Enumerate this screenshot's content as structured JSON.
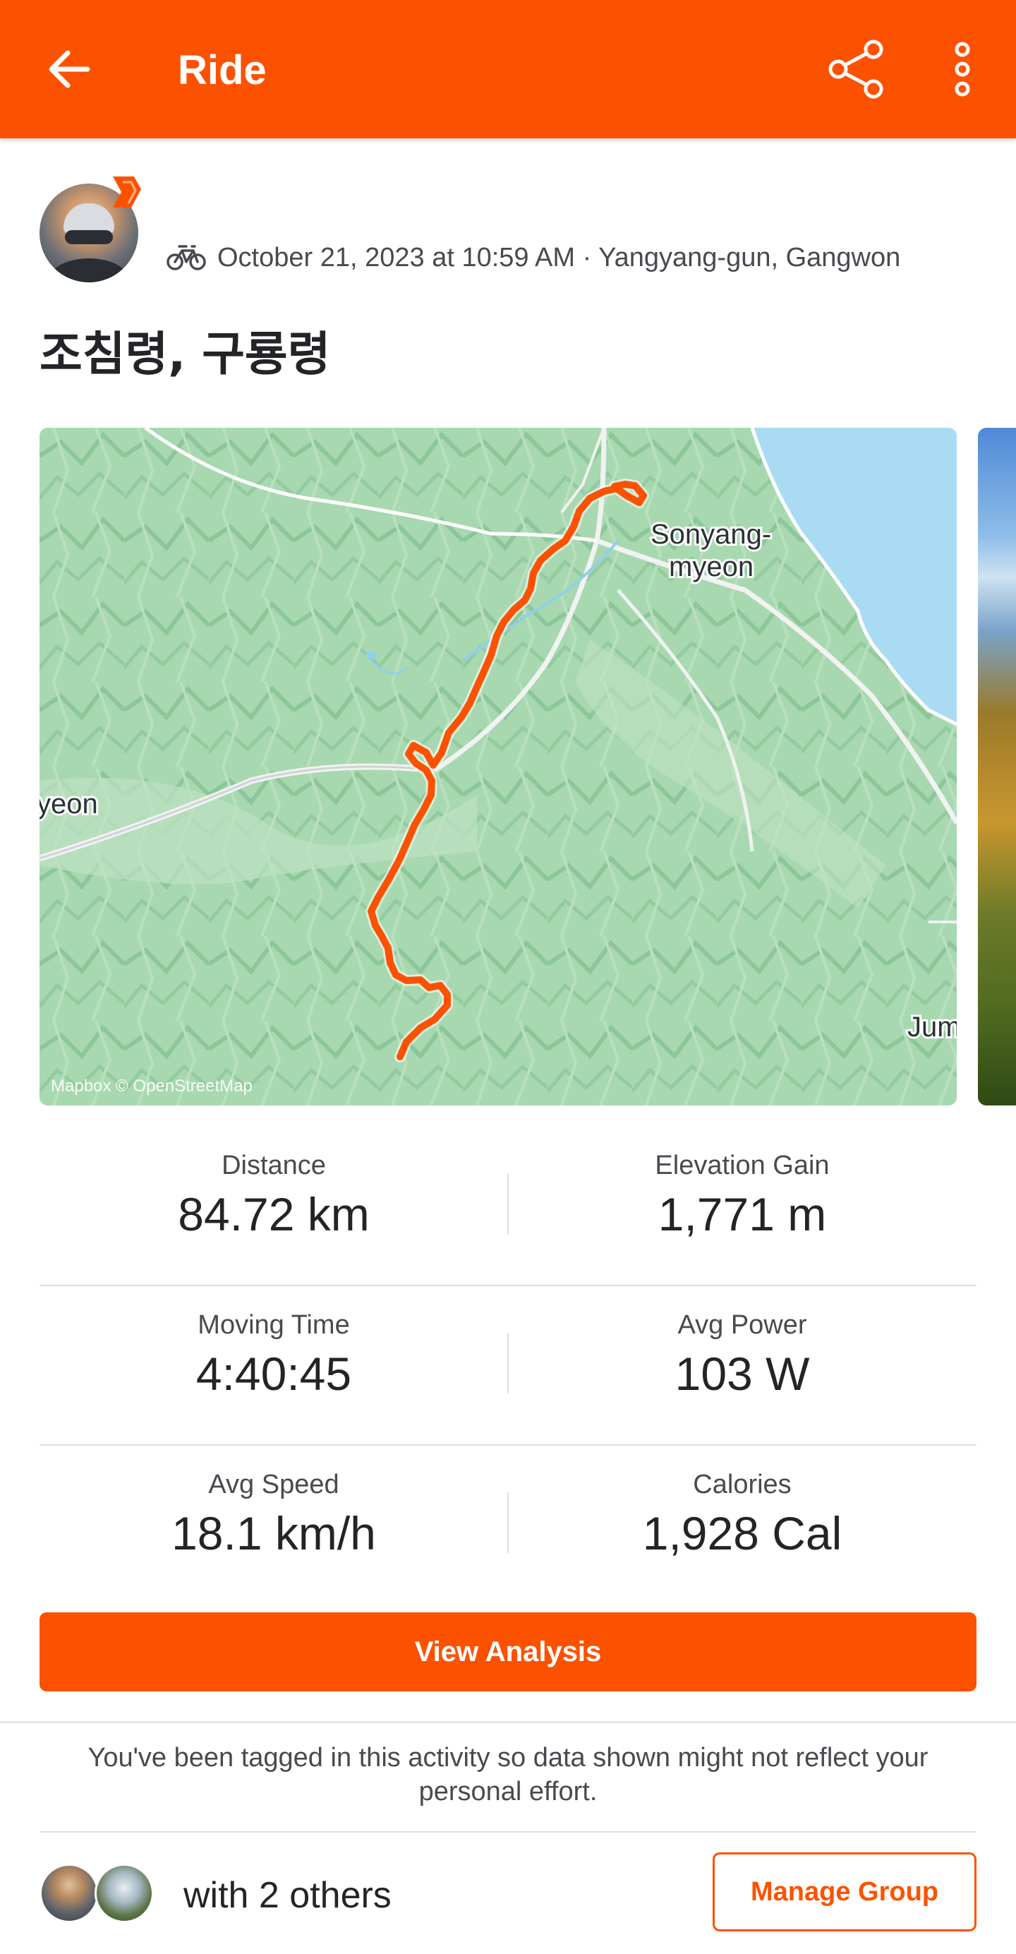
{
  "appbar": {
    "title": "Ride",
    "back_icon": "arrow-left-icon",
    "share_icon": "share-icon",
    "more_icon": "more-vertical-icon",
    "background": "#fc5200"
  },
  "activity": {
    "datetime_location": "October 21, 2023 at 10:59 AM · Yangyang-gun, Gangwon",
    "sport_icon": "bike-icon",
    "title": "조침령, 구룡령"
  },
  "map": {
    "labels": {
      "sonyang": "Sonyang-",
      "myeon": "myeon",
      "left": "yeon",
      "right": "Jum"
    },
    "attribution": "Mapbox © OpenStreetMap",
    "route_color": "#fc5200"
  },
  "stats": [
    {
      "label": "Distance",
      "value": "84.72 km"
    },
    {
      "label": "Elevation Gain",
      "value": "1,771 m"
    },
    {
      "label": "Moving Time",
      "value": "4:40:45"
    },
    {
      "label": "Avg Power",
      "value": "103 W"
    },
    {
      "label": "Avg Speed",
      "value": "18.1 km/h"
    },
    {
      "label": "Calories",
      "value": "1,928 Cal"
    }
  ],
  "buttons": {
    "view_analysis": "View Analysis",
    "manage_group": "Manage Group"
  },
  "tag_note": "You've been tagged in this activity so data shown might not reflect your personal effort.",
  "group": {
    "with_others": "with 2 others"
  },
  "colors": {
    "accent": "#fc5200",
    "text_primary": "#242428",
    "text_secondary": "#494950"
  }
}
